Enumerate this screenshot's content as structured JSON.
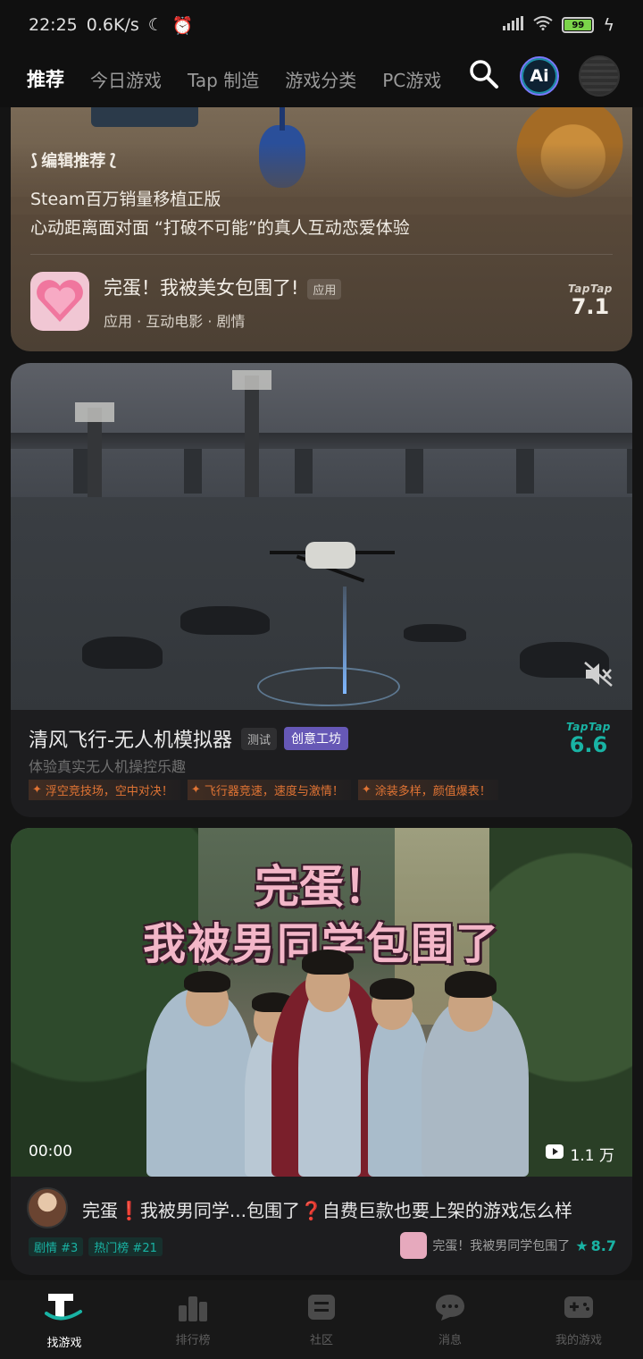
{
  "status_bar": {
    "time": "22:25",
    "net_speed": "0.6K/s",
    "battery": "99"
  },
  "top_nav": {
    "tabs": [
      {
        "label": "推荐",
        "active": true
      },
      {
        "label": "今日游戏",
        "active": false
      },
      {
        "label": "Tap 制造",
        "active": false
      },
      {
        "label": "游戏分类",
        "active": false
      },
      {
        "label": "PC游戏",
        "active": false
      }
    ],
    "ai_label": "Ai"
  },
  "card1": {
    "editor_label": "编辑推荐",
    "desc_line1": "Steam百万销量移植正版",
    "desc_line2": "心动距离面对面 “打破不可能”的真人互动恋爱体验",
    "app_name": "完蛋！我被美女包围了!",
    "app_tag": "应用",
    "app_meta": "应用 · 互动电影 · 剧情",
    "rating_brand": "TapTap",
    "rating": "7.1"
  },
  "card2": {
    "title": "清风飞行-无人机模拟器",
    "badge_test": "测试",
    "badge_creative": "创意工坊",
    "subtitle": "体验真实无人机操控乐趣",
    "highlights": [
      "浮空竞技场，空中对决！",
      "飞行器竞速，速度与激情！",
      "涂装多样，颜值爆表！"
    ],
    "rating_brand": "TapTap",
    "rating": "6.6"
  },
  "card3": {
    "headline_line1": "完蛋！",
    "headline_line2": "我被男同学包围了",
    "video_time": "00:00",
    "video_views": "1.1 万",
    "post_title": "完蛋❗我被男同学...包围了❓自费巨款也要上架的游戏怎么样",
    "ranks": [
      "剧情 #3",
      "热门榜 #21"
    ],
    "game_name": "完蛋！我被男同学包围了",
    "game_rating": "8.7"
  },
  "bottom_nav": [
    {
      "label": "找游戏",
      "icon": "find-games-icon",
      "active": true
    },
    {
      "label": "排行榜",
      "icon": "ranking-icon",
      "active": false
    },
    {
      "label": "社区",
      "icon": "community-icon",
      "active": false
    },
    {
      "label": "消息",
      "icon": "message-icon",
      "active": false
    },
    {
      "label": "我的游戏",
      "icon": "my-games-icon",
      "active": false
    }
  ],
  "colors": {
    "accent": "#19b3a4",
    "creative_badge": "#6658b6",
    "highlight": "#e07434"
  }
}
